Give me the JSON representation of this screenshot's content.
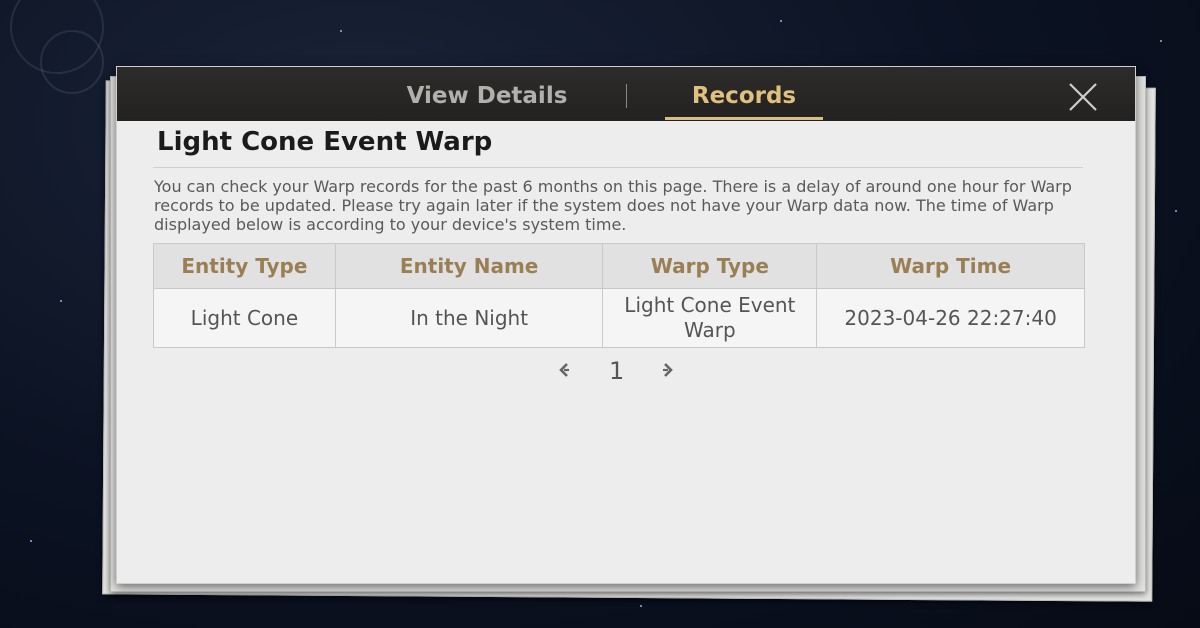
{
  "tabs": [
    {
      "label": "View Details",
      "active": false
    },
    {
      "label": "Records",
      "active": true
    }
  ],
  "close_icon": "close-x-icon",
  "title": "Light Cone Event Warp",
  "description": "You can check your Warp records for the past 6 months on this page. There is a delay of around one hour for Warp records to be updated. Please try again later if the system does not have your Warp data now. The time of Warp displayed below is according to your device's system time.",
  "table": {
    "headers": [
      "Entity Type",
      "Entity Name",
      "Warp Type",
      "Warp Time"
    ],
    "rows": [
      [
        "Light Cone",
        "In the Night",
        "Light Cone Event Warp",
        "2023-04-26 22:27:40"
      ]
    ]
  },
  "pagination": {
    "prev_icon": "chevron-left-icon",
    "page": "1",
    "next_icon": "chevron-right-icon"
  },
  "colors": {
    "accent_gold": "#e0c07d",
    "item_gold": "#d2a04e",
    "header_text": "#9a7f55"
  }
}
